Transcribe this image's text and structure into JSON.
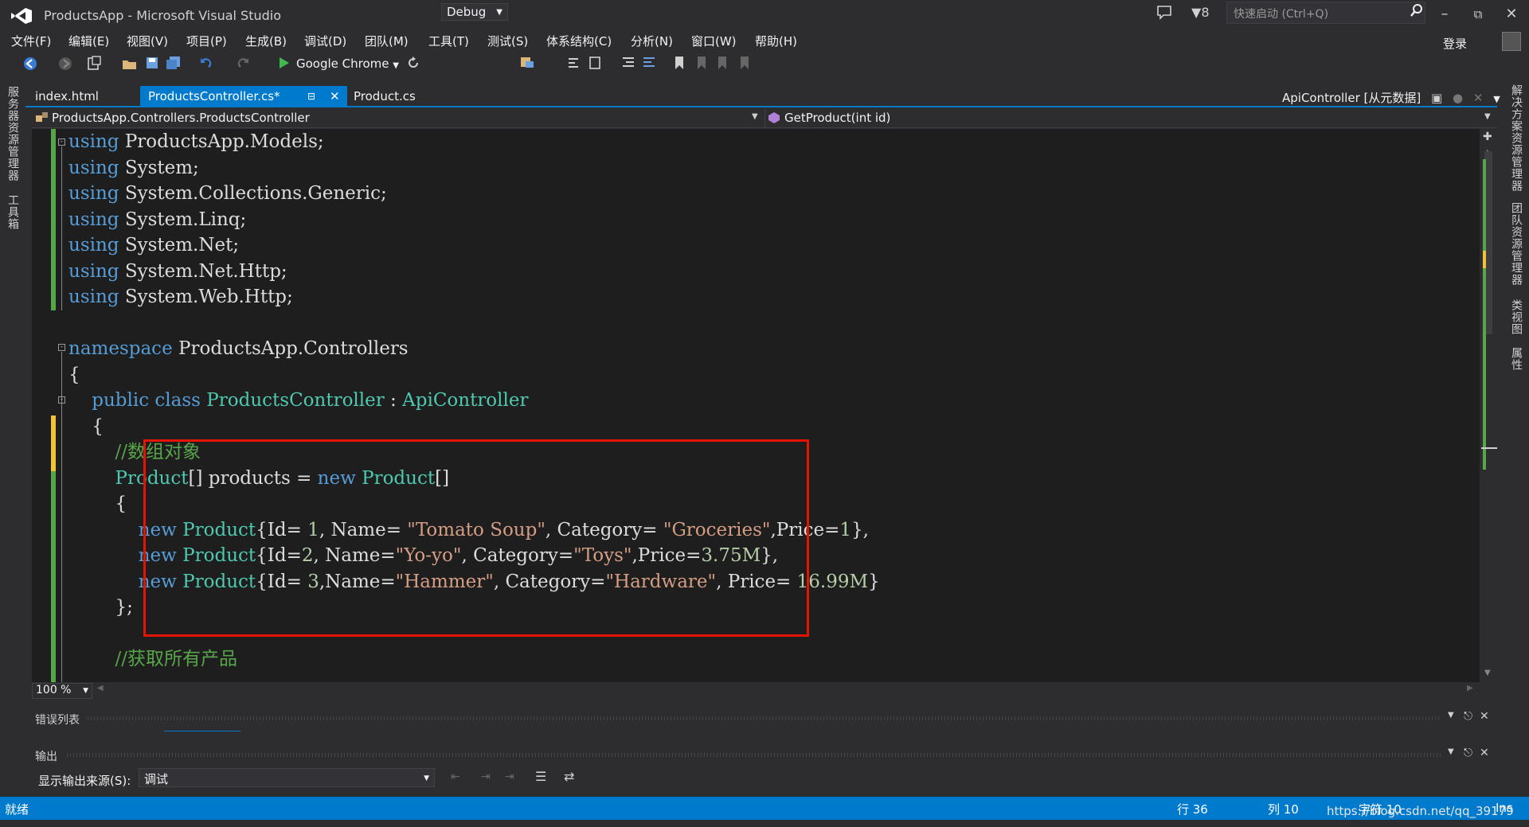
{
  "window": {
    "title": "ProductsApp - Microsoft Visual Studio",
    "notification_count": "8",
    "quick_launch_placeholder": "快速启动 (Ctrl+Q)",
    "login": "登录"
  },
  "menu": [
    "文件(F)",
    "编辑(E)",
    "视图(V)",
    "项目(P)",
    "生成(B)",
    "调试(D)",
    "团队(M)",
    "工具(T)",
    "测试(S)",
    "体系结构(C)",
    "分析(N)",
    "窗口(W)",
    "帮助(H)"
  ],
  "toolbar": {
    "run_target": "Google Chrome",
    "configuration": "Debug"
  },
  "side_panels": {
    "left": [
      "服务器资源管理器",
      "工具箱"
    ],
    "right": [
      "解决方案资源管理器",
      "团队资源管理器",
      "类视图",
      "属性"
    ]
  },
  "tabs": [
    {
      "label": "index.html",
      "active": false
    },
    {
      "label": "ProductsController.cs*",
      "active": true
    },
    {
      "label": "Product.cs",
      "active": false
    }
  ],
  "preview_tab": "ApiController [从元数据]",
  "navigation": {
    "type": "ProductsApp.Controllers.ProductsController",
    "member": "GetProduct(int id)"
  },
  "code_lines": [
    [
      {
        "t": "using",
        "c": "kw"
      },
      {
        "t": " ProductsApp.Models;"
      }
    ],
    [
      {
        "t": "using",
        "c": "kw"
      },
      {
        "t": " System;"
      }
    ],
    [
      {
        "t": "using",
        "c": "kw"
      },
      {
        "t": " System.Collections.Generic;"
      }
    ],
    [
      {
        "t": "using",
        "c": "kw"
      },
      {
        "t": " System.Linq;"
      }
    ],
    [
      {
        "t": "using",
        "c": "kw"
      },
      {
        "t": " System.Net;"
      }
    ],
    [
      {
        "t": "using",
        "c": "kw"
      },
      {
        "t": " System.Net.Http;"
      }
    ],
    [
      {
        "t": "using",
        "c": "kw"
      },
      {
        "t": " System.Web.Http;"
      }
    ],
    [],
    [
      {
        "t": "namespace",
        "c": "kw"
      },
      {
        "t": " ProductsApp.Controllers"
      }
    ],
    [
      {
        "t": "{"
      }
    ],
    [
      {
        "t": "    "
      },
      {
        "t": "public",
        "c": "kw"
      },
      {
        "t": " "
      },
      {
        "t": "class",
        "c": "kw"
      },
      {
        "t": " "
      },
      {
        "t": "ProductsController",
        "c": "ty"
      },
      {
        "t": " : "
      },
      {
        "t": "ApiController",
        "c": "ty"
      }
    ],
    [
      {
        "t": "    {"
      }
    ],
    [
      {
        "t": "        "
      },
      {
        "t": "//数组对象",
        "c": "cm"
      }
    ],
    [
      {
        "t": "        "
      },
      {
        "t": "Product",
        "c": "ty"
      },
      {
        "t": "[] products = "
      },
      {
        "t": "new",
        "c": "kw"
      },
      {
        "t": " "
      },
      {
        "t": "Product",
        "c": "ty"
      },
      {
        "t": "[]"
      }
    ],
    [
      {
        "t": "        {"
      }
    ],
    [
      {
        "t": "            "
      },
      {
        "t": "new",
        "c": "kw"
      },
      {
        "t": " "
      },
      {
        "t": "Product",
        "c": "ty"
      },
      {
        "t": "{Id= "
      },
      {
        "t": "1",
        "c": "nu"
      },
      {
        "t": ", Name= "
      },
      {
        "t": "\"Tomato Soup\"",
        "c": "st"
      },
      {
        "t": ", Category= "
      },
      {
        "t": "\"Groceries\"",
        "c": "st"
      },
      {
        "t": ",Price="
      },
      {
        "t": "1",
        "c": "nu"
      },
      {
        "t": "},"
      }
    ],
    [
      {
        "t": "            "
      },
      {
        "t": "new",
        "c": "kw"
      },
      {
        "t": " "
      },
      {
        "t": "Product",
        "c": "ty"
      },
      {
        "t": "{Id="
      },
      {
        "t": "2",
        "c": "nu"
      },
      {
        "t": ", Name="
      },
      {
        "t": "\"Yo-yo\"",
        "c": "st"
      },
      {
        "t": ", Category="
      },
      {
        "t": "\"Toys\"",
        "c": "st"
      },
      {
        "t": ",Price="
      },
      {
        "t": "3.75M",
        "c": "nu"
      },
      {
        "t": "},"
      }
    ],
    [
      {
        "t": "            "
      },
      {
        "t": "new",
        "c": "kw"
      },
      {
        "t": " "
      },
      {
        "t": "Product",
        "c": "ty"
      },
      {
        "t": "{Id= "
      },
      {
        "t": "3",
        "c": "nu"
      },
      {
        "t": ",Name="
      },
      {
        "t": "\"Hammer\"",
        "c": "st"
      },
      {
        "t": ", Category="
      },
      {
        "t": "\"Hardware\"",
        "c": "st"
      },
      {
        "t": ", Price= "
      },
      {
        "t": "16.99M",
        "c": "nu"
      },
      {
        "t": "}"
      }
    ],
    [
      {
        "t": "        };"
      }
    ],
    [],
    [
      {
        "t": "        "
      },
      {
        "t": "//获取所有产品",
        "c": "cm"
      }
    ]
  ],
  "editor": {
    "zoom": "100 %"
  },
  "panels": {
    "error_list": "错误列表",
    "output": "输出",
    "output_source_label": "显示输出来源(S):",
    "output_source": "调试"
  },
  "status": {
    "ready": "就绪",
    "row": "行 36",
    "col": "列 10",
    "char": "字符 10",
    "ins": "Ins",
    "watermark": "https://blog.csdn.net/qq_39179"
  },
  "colors": {
    "accent": "#007acc",
    "highlight_box": "#e51400",
    "keyword": "#569cd6",
    "type": "#4ec9b0",
    "string": "#d69d85",
    "comment": "#57a64a"
  }
}
